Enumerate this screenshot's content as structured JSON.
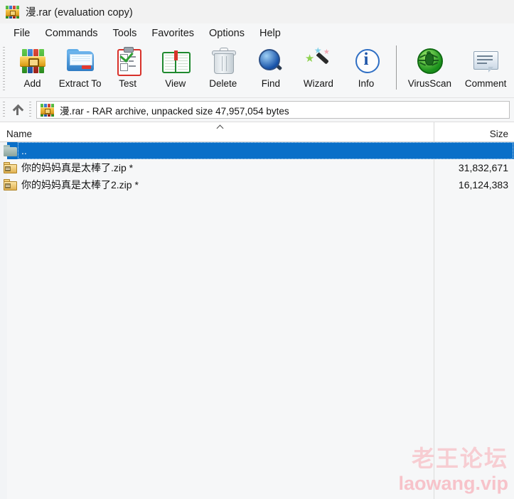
{
  "window": {
    "title": "漫.rar (evaluation copy)",
    "icon": "winrar-books-icon"
  },
  "menu": {
    "items": [
      {
        "label": "File"
      },
      {
        "label": "Commands"
      },
      {
        "label": "Tools"
      },
      {
        "label": "Favorites"
      },
      {
        "label": "Options"
      },
      {
        "label": "Help"
      }
    ]
  },
  "toolbar": {
    "buttons": [
      {
        "label": "Add",
        "icon": "add-archive-icon"
      },
      {
        "label": "Extract To",
        "icon": "extract-folder-icon"
      },
      {
        "label": "Test",
        "icon": "test-clipboard-icon"
      },
      {
        "label": "View",
        "icon": "view-book-icon"
      },
      {
        "label": "Delete",
        "icon": "delete-trash-icon"
      },
      {
        "label": "Find",
        "icon": "find-magnifier-icon"
      },
      {
        "label": "Wizard",
        "icon": "wizard-wand-icon"
      },
      {
        "label": "Info",
        "icon": "info-circle-icon"
      },
      {
        "label": "VirusScan",
        "icon": "virusscan-bug-icon"
      },
      {
        "label": "Comment",
        "icon": "comment-bubble-icon"
      }
    ]
  },
  "pathbar": {
    "up_icon": "up-arrow-icon",
    "archive_icon": "winrar-books-icon",
    "text": "漫.rar - RAR archive, unpacked size 47,957,054 bytes"
  },
  "list": {
    "columns": [
      {
        "key": "name",
        "label": "Name"
      },
      {
        "key": "size",
        "label": "Size"
      }
    ],
    "sort_indicator": "sort-ascending-chevron",
    "rows": [
      {
        "name": "..",
        "size": "",
        "icon": "parent-folder-icon",
        "selected": true
      },
      {
        "name": "你的妈妈真是太棒了.zip *",
        "size": "31,832,671",
        "icon": "zip-archive-icon",
        "selected": false
      },
      {
        "name": "你的妈妈真是太棒了2.zip *",
        "size": "16,124,383",
        "icon": "zip-archive-icon",
        "selected": false
      }
    ]
  },
  "watermark": {
    "chinese": "老王论坛",
    "latin": "laowang.vip",
    "color": "#f7cdd2"
  },
  "colors": {
    "selection": "#0a6fc8",
    "background": "#f6f7f8",
    "titlebar": "#f2f2f2"
  }
}
